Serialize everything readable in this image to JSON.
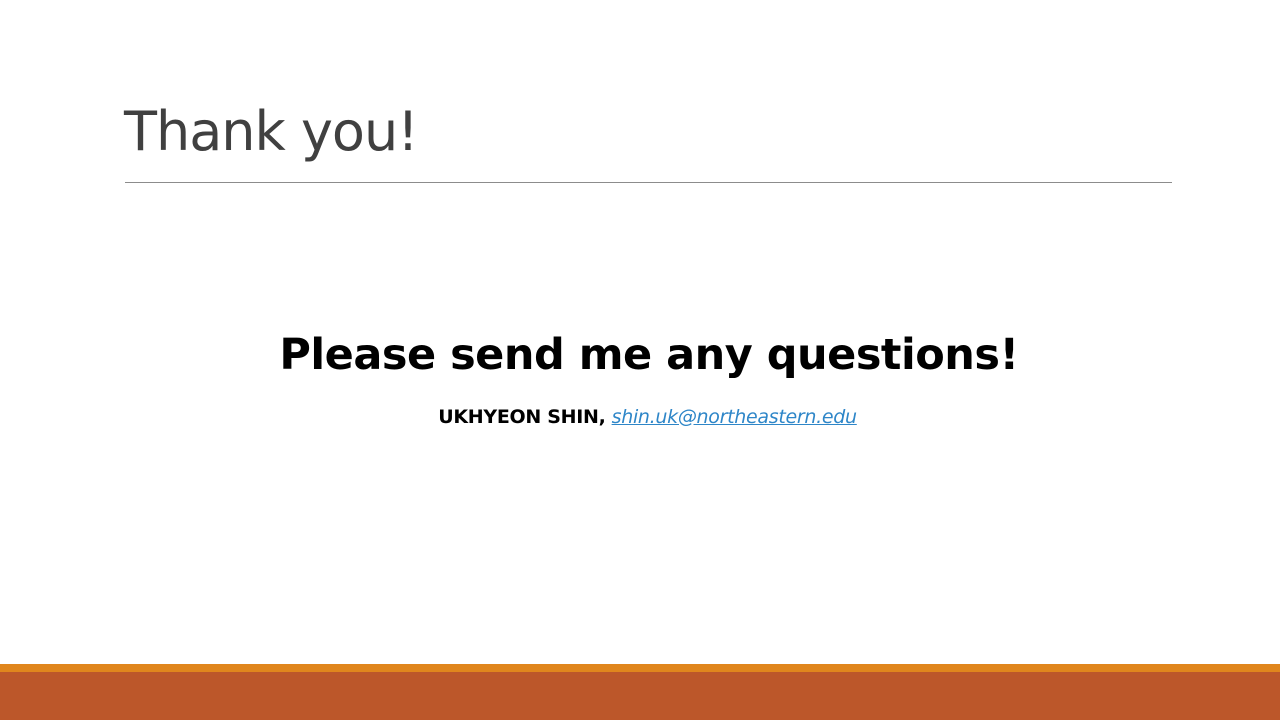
{
  "slide": {
    "title": "Thank you!",
    "message": "Please send me any questions!",
    "contact": {
      "name": "UKHYEON SHIN,",
      "email": "shin.uk@northeastern.edu"
    }
  },
  "colors": {
    "title_text": "#404040",
    "link": "#2e86c8",
    "footer_accent": "#e0861d",
    "footer_band": "#bc572a"
  }
}
